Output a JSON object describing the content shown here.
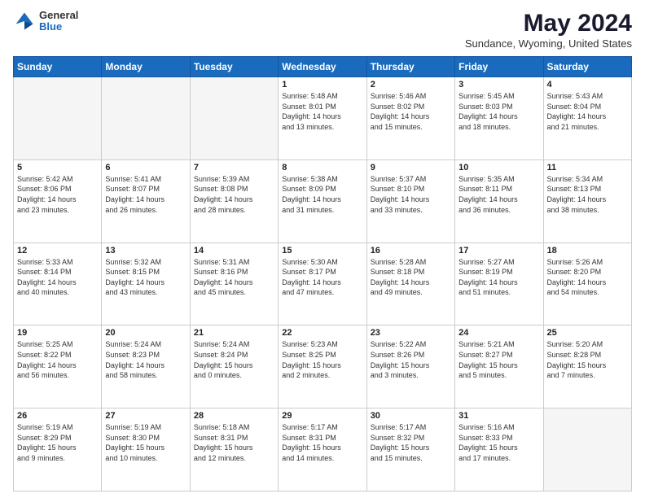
{
  "header": {
    "logo_general": "General",
    "logo_blue": "Blue",
    "month": "May 2024",
    "location": "Sundance, Wyoming, United States"
  },
  "weekdays": [
    "Sunday",
    "Monday",
    "Tuesday",
    "Wednesday",
    "Thursday",
    "Friday",
    "Saturday"
  ],
  "weeks": [
    [
      {
        "day": "",
        "info": ""
      },
      {
        "day": "",
        "info": ""
      },
      {
        "day": "",
        "info": ""
      },
      {
        "day": "1",
        "info": "Sunrise: 5:48 AM\nSunset: 8:01 PM\nDaylight: 14 hours\nand 13 minutes."
      },
      {
        "day": "2",
        "info": "Sunrise: 5:46 AM\nSunset: 8:02 PM\nDaylight: 14 hours\nand 15 minutes."
      },
      {
        "day": "3",
        "info": "Sunrise: 5:45 AM\nSunset: 8:03 PM\nDaylight: 14 hours\nand 18 minutes."
      },
      {
        "day": "4",
        "info": "Sunrise: 5:43 AM\nSunset: 8:04 PM\nDaylight: 14 hours\nand 21 minutes."
      }
    ],
    [
      {
        "day": "5",
        "info": "Sunrise: 5:42 AM\nSunset: 8:06 PM\nDaylight: 14 hours\nand 23 minutes."
      },
      {
        "day": "6",
        "info": "Sunrise: 5:41 AM\nSunset: 8:07 PM\nDaylight: 14 hours\nand 26 minutes."
      },
      {
        "day": "7",
        "info": "Sunrise: 5:39 AM\nSunset: 8:08 PM\nDaylight: 14 hours\nand 28 minutes."
      },
      {
        "day": "8",
        "info": "Sunrise: 5:38 AM\nSunset: 8:09 PM\nDaylight: 14 hours\nand 31 minutes."
      },
      {
        "day": "9",
        "info": "Sunrise: 5:37 AM\nSunset: 8:10 PM\nDaylight: 14 hours\nand 33 minutes."
      },
      {
        "day": "10",
        "info": "Sunrise: 5:35 AM\nSunset: 8:11 PM\nDaylight: 14 hours\nand 36 minutes."
      },
      {
        "day": "11",
        "info": "Sunrise: 5:34 AM\nSunset: 8:13 PM\nDaylight: 14 hours\nand 38 minutes."
      }
    ],
    [
      {
        "day": "12",
        "info": "Sunrise: 5:33 AM\nSunset: 8:14 PM\nDaylight: 14 hours\nand 40 minutes."
      },
      {
        "day": "13",
        "info": "Sunrise: 5:32 AM\nSunset: 8:15 PM\nDaylight: 14 hours\nand 43 minutes."
      },
      {
        "day": "14",
        "info": "Sunrise: 5:31 AM\nSunset: 8:16 PM\nDaylight: 14 hours\nand 45 minutes."
      },
      {
        "day": "15",
        "info": "Sunrise: 5:30 AM\nSunset: 8:17 PM\nDaylight: 14 hours\nand 47 minutes."
      },
      {
        "day": "16",
        "info": "Sunrise: 5:28 AM\nSunset: 8:18 PM\nDaylight: 14 hours\nand 49 minutes."
      },
      {
        "day": "17",
        "info": "Sunrise: 5:27 AM\nSunset: 8:19 PM\nDaylight: 14 hours\nand 51 minutes."
      },
      {
        "day": "18",
        "info": "Sunrise: 5:26 AM\nSunset: 8:20 PM\nDaylight: 14 hours\nand 54 minutes."
      }
    ],
    [
      {
        "day": "19",
        "info": "Sunrise: 5:25 AM\nSunset: 8:22 PM\nDaylight: 14 hours\nand 56 minutes."
      },
      {
        "day": "20",
        "info": "Sunrise: 5:24 AM\nSunset: 8:23 PM\nDaylight: 14 hours\nand 58 minutes."
      },
      {
        "day": "21",
        "info": "Sunrise: 5:24 AM\nSunset: 8:24 PM\nDaylight: 15 hours\nand 0 minutes."
      },
      {
        "day": "22",
        "info": "Sunrise: 5:23 AM\nSunset: 8:25 PM\nDaylight: 15 hours\nand 2 minutes."
      },
      {
        "day": "23",
        "info": "Sunrise: 5:22 AM\nSunset: 8:26 PM\nDaylight: 15 hours\nand 3 minutes."
      },
      {
        "day": "24",
        "info": "Sunrise: 5:21 AM\nSunset: 8:27 PM\nDaylight: 15 hours\nand 5 minutes."
      },
      {
        "day": "25",
        "info": "Sunrise: 5:20 AM\nSunset: 8:28 PM\nDaylight: 15 hours\nand 7 minutes."
      }
    ],
    [
      {
        "day": "26",
        "info": "Sunrise: 5:19 AM\nSunset: 8:29 PM\nDaylight: 15 hours\nand 9 minutes."
      },
      {
        "day": "27",
        "info": "Sunrise: 5:19 AM\nSunset: 8:30 PM\nDaylight: 15 hours\nand 10 minutes."
      },
      {
        "day": "28",
        "info": "Sunrise: 5:18 AM\nSunset: 8:31 PM\nDaylight: 15 hours\nand 12 minutes."
      },
      {
        "day": "29",
        "info": "Sunrise: 5:17 AM\nSunset: 8:31 PM\nDaylight: 15 hours\nand 14 minutes."
      },
      {
        "day": "30",
        "info": "Sunrise: 5:17 AM\nSunset: 8:32 PM\nDaylight: 15 hours\nand 15 minutes."
      },
      {
        "day": "31",
        "info": "Sunrise: 5:16 AM\nSunset: 8:33 PM\nDaylight: 15 hours\nand 17 minutes."
      },
      {
        "day": "",
        "info": ""
      }
    ]
  ]
}
